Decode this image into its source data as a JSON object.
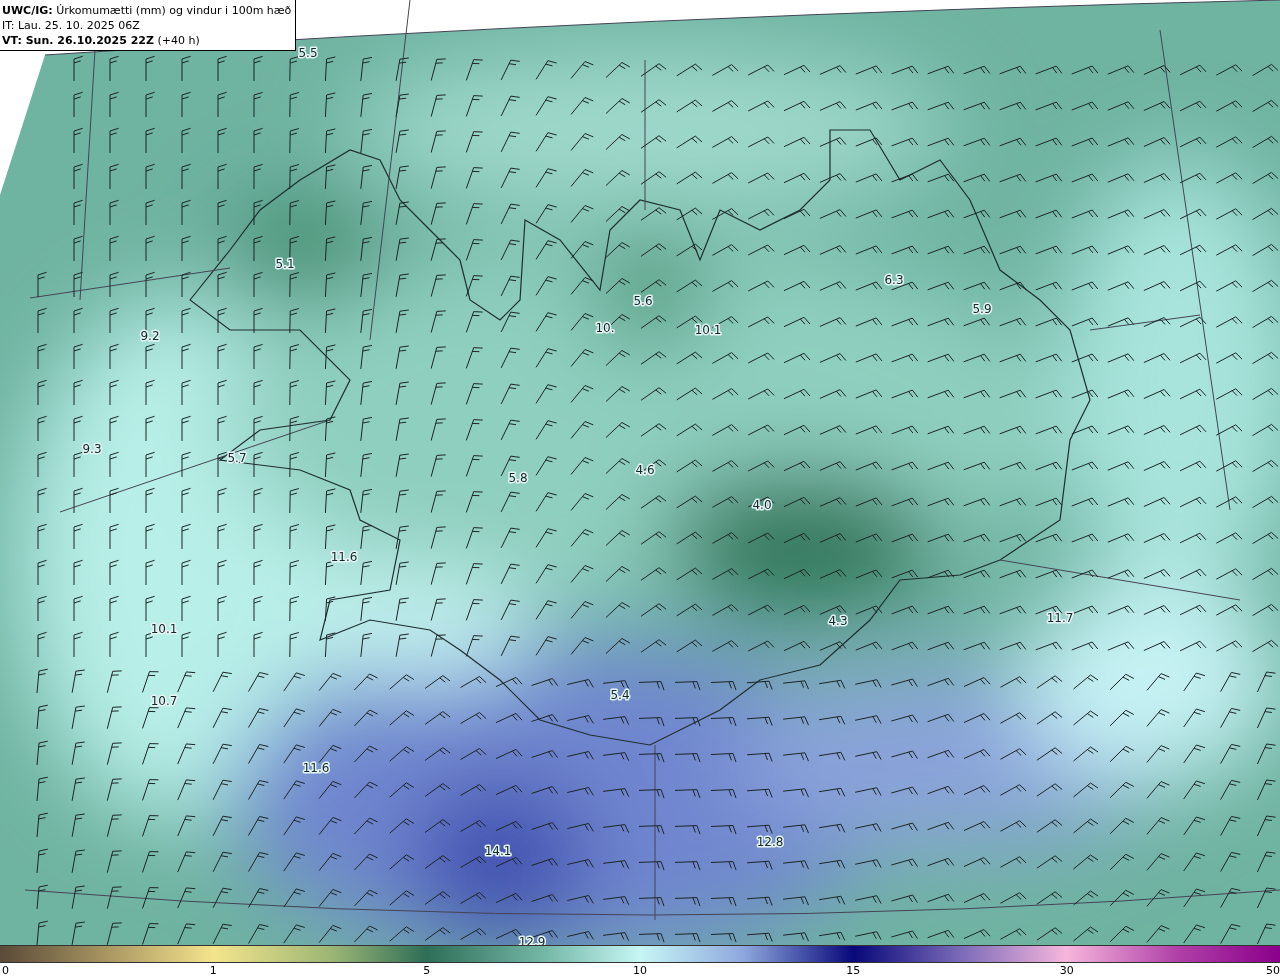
{
  "header": {
    "title": "**UWC/IG:** Úrkomumætti (mm) og vindur i 100m hæð",
    "issued": "IT: Lau. 25. 10. 2025 06Z",
    "valid": "**VT: Sun. 26.10.2025 22Z** (+40 h)"
  },
  "map": {
    "values": [
      "5.5",
      "5.1",
      "9.2",
      "9.3",
      "5.7",
      "5.8",
      "10.",
      "10.1",
      "5.6",
      "6.3",
      "5.9",
      "4.6",
      "4.0",
      "4.3",
      "5.4",
      "11.6",
      "10.1",
      "10.7",
      "11.6",
      "11.7",
      "14.1",
      "12.8",
      "12.9"
    ]
  },
  "colorbar": {
    "ticks": [
      "0",
      "1",
      "5",
      "10",
      "15",
      "30",
      "50"
    ]
  }
}
